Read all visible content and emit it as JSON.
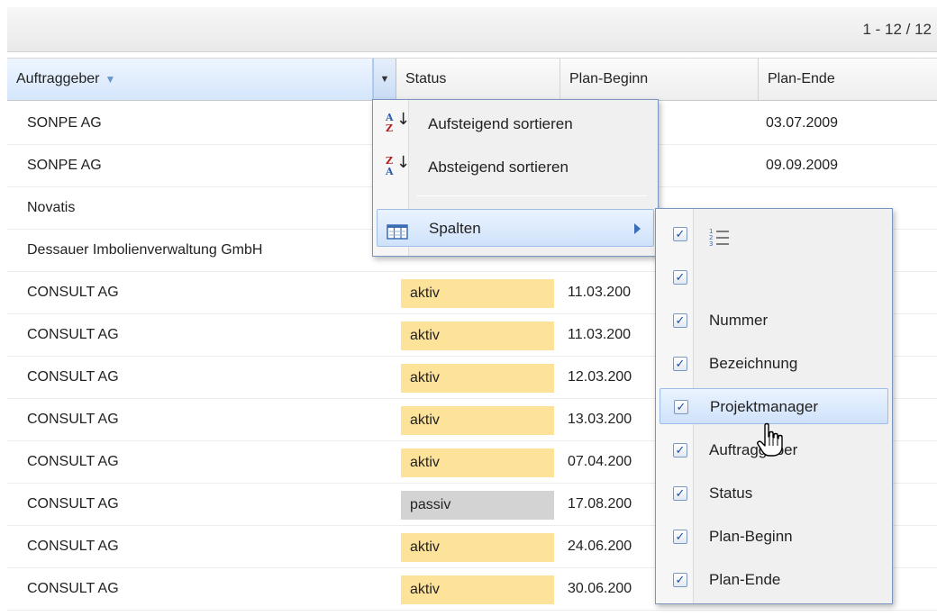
{
  "paging": {
    "text": "1 - 12 / 12"
  },
  "columns": {
    "client": "Auftraggeber",
    "status": "Status",
    "plan_start": "Plan-Beginn",
    "plan_end": "Plan-Ende"
  },
  "rows": [
    {
      "client": "SONPE AG",
      "status": "",
      "plan_start": "",
      "plan_end": "03.07.2009"
    },
    {
      "client": "SONPE AG",
      "status": "",
      "plan_start": "",
      "plan_end": "09.09.2009"
    },
    {
      "client": "Novatis",
      "status": "",
      "plan_start": "",
      "plan_end": ""
    },
    {
      "client": "Dessauer Imbolienverwaltung GmbH",
      "status": "",
      "plan_start": "",
      "plan_end": ""
    },
    {
      "client": "CONSULT AG",
      "status": "aktiv",
      "plan_start": "11.03.200",
      "plan_end": ""
    },
    {
      "client": "CONSULT AG",
      "status": "aktiv",
      "plan_start": "11.03.200",
      "plan_end": ""
    },
    {
      "client": "CONSULT AG",
      "status": "aktiv",
      "plan_start": "12.03.200",
      "plan_end": ""
    },
    {
      "client": "CONSULT AG",
      "status": "aktiv",
      "plan_start": "13.03.200",
      "plan_end": ""
    },
    {
      "client": "CONSULT AG",
      "status": "aktiv",
      "plan_start": "07.04.200",
      "plan_end": ""
    },
    {
      "client": "CONSULT AG",
      "status": "passiv",
      "plan_start": "17.08.200",
      "plan_end": ""
    },
    {
      "client": "CONSULT AG",
      "status": "aktiv",
      "plan_start": "24.06.200",
      "plan_end": ""
    },
    {
      "client": "CONSULT AG",
      "status": "aktiv",
      "plan_start": "30.06.200",
      "plan_end": ""
    }
  ],
  "column_menu": {
    "sort_asc": "Aufsteigend sortieren",
    "sort_desc": "Absteigend sortieren",
    "columns": "Spalten"
  },
  "columns_submenu": {
    "items": [
      {
        "label": "",
        "checked": true,
        "icon": "numbered-list-icon"
      },
      {
        "label": "",
        "checked": true
      },
      {
        "label": "Nummer",
        "checked": true
      },
      {
        "label": "Bezeichnung",
        "checked": true
      },
      {
        "label": "Projektmanager",
        "checked": true
      },
      {
        "label": "Auftraggeber",
        "checked": true
      },
      {
        "label": "Status",
        "checked": true
      },
      {
        "label": "Plan-Beginn",
        "checked": true
      },
      {
        "label": "Plan-Ende",
        "checked": true
      }
    ]
  },
  "colors": {
    "status_active": "#fde29a",
    "status_passive": "#d3d3d3",
    "menu_highlight": "#cfe2fa"
  }
}
